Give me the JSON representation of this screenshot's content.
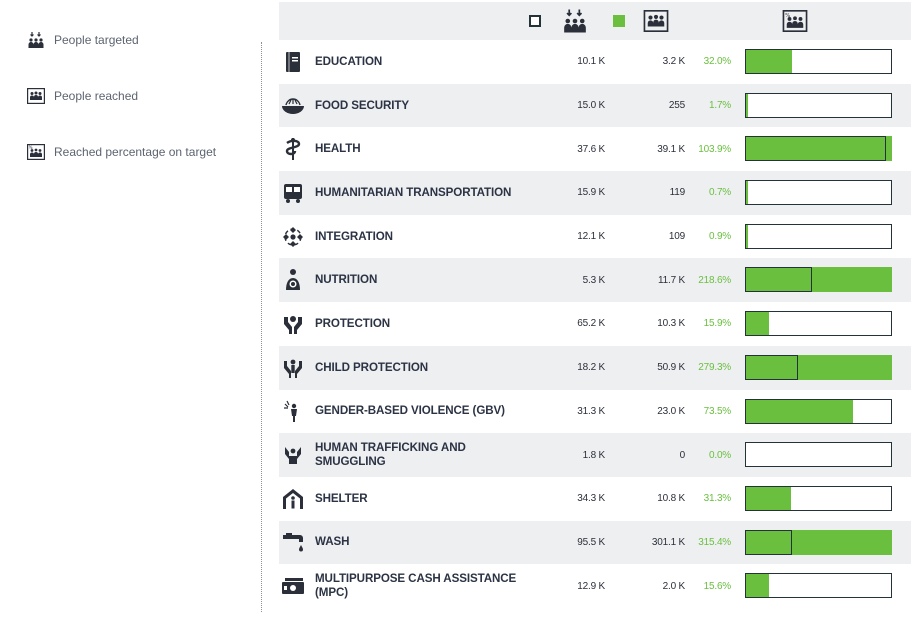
{
  "legend": [
    {
      "icon": "people-targeted-icon",
      "label": "People targeted"
    },
    {
      "icon": "people-reached-icon",
      "label": "People reached"
    },
    {
      "icon": "reached-percentage-icon",
      "label": "Reached percentage on target"
    }
  ],
  "colors": {
    "accent": "#6abf3f",
    "dark": "#24323a",
    "rowAlt": "#eeeff1"
  },
  "header_icons": [
    "legend-square-icon",
    "people-targeted-icon",
    "green-square-icon",
    "people-reached-icon",
    "reached-percentage-icon"
  ],
  "rows": [
    {
      "icon": "education-icon",
      "sector": "EDUCATION",
      "targeted": "10.1 K",
      "reached": "3.2 K",
      "percent": "32.0%",
      "pct": 32.0
    },
    {
      "icon": "food-security-icon",
      "sector": "FOOD SECURITY",
      "targeted": "15.0 K",
      "reached": "255",
      "percent": "1.7%",
      "pct": 1.7
    },
    {
      "icon": "health-icon",
      "sector": "HEALTH",
      "targeted": "37.6 K",
      "reached": "39.1 K",
      "percent": "103.9%",
      "pct": 103.9
    },
    {
      "icon": "bus-icon",
      "sector": "HUMANITARIAN TRANSPORTATION",
      "targeted": "15.9 K",
      "reached": "119",
      "percent": "0.7%",
      "pct": 0.7
    },
    {
      "icon": "integration-icon",
      "sector": "INTEGRATION",
      "targeted": "12.1 K",
      "reached": "109",
      "percent": "0.9%",
      "pct": 0.9
    },
    {
      "icon": "nutrition-icon",
      "sector": "NUTRITION",
      "targeted": "5.3 K",
      "reached": "11.7 K",
      "percent": "218.6%",
      "pct": 218.6
    },
    {
      "icon": "protection-icon",
      "sector": "PROTECTION",
      "targeted": "65.2 K",
      "reached": "10.3 K",
      "percent": "15.9%",
      "pct": 15.9
    },
    {
      "icon": "child-protection-icon",
      "sector": "CHILD PROTECTION",
      "targeted": "18.2 K",
      "reached": "50.9 K",
      "percent": "279.3%",
      "pct": 279.3
    },
    {
      "icon": "gbv-icon",
      "sector": "GENDER-BASED VIOLENCE (GBV)",
      "targeted": "31.3 K",
      "reached": "23.0 K",
      "percent": "73.5%",
      "pct": 73.5
    },
    {
      "icon": "trafficking-icon",
      "sector": "HUMAN TRAFFICKING AND SMUGGLING",
      "targeted": "1.8 K",
      "reached": "0",
      "percent": "0.0%",
      "pct": 0.0
    },
    {
      "icon": "shelter-icon",
      "sector": "SHELTER",
      "targeted": "34.3 K",
      "reached": "10.8 K",
      "percent": "31.3%",
      "pct": 31.3
    },
    {
      "icon": "wash-icon",
      "sector": "WASH",
      "targeted": "95.5 K",
      "reached": "301.1 K",
      "percent": "315.4%",
      "pct": 315.4
    },
    {
      "icon": "cash-icon",
      "sector": "MULTIPURPOSE CASH ASSISTANCE (MPC)",
      "targeted": "12.9 K",
      "reached": "2.0 K",
      "percent": "15.6%",
      "pct": 15.6
    }
  ]
}
